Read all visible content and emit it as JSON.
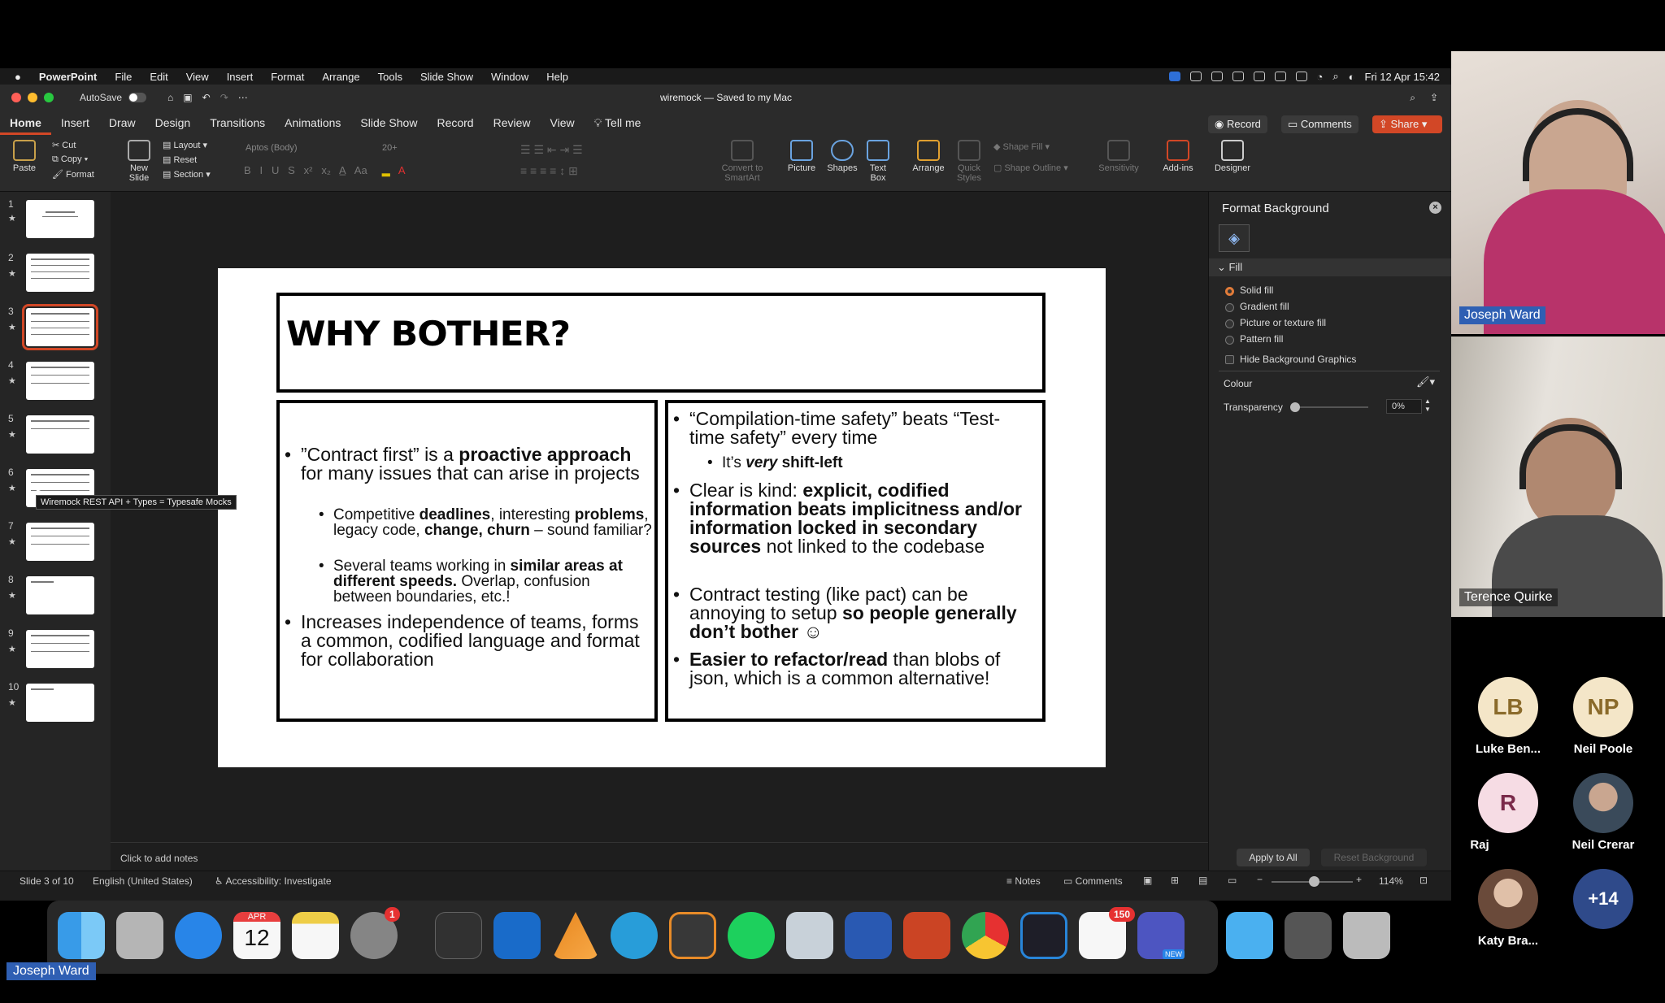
{
  "menubar": {
    "app": "PowerPoint",
    "items": [
      "File",
      "Edit",
      "View",
      "Insert",
      "Format",
      "Arrange",
      "Tools",
      "Slide Show",
      "Window",
      "Help"
    ],
    "clock": "Fri 12 Apr  15:42"
  },
  "titlebar": {
    "autosave": "AutoSave",
    "doc": "wiremock — Saved to my Mac"
  },
  "tabs": [
    "Home",
    "Insert",
    "Draw",
    "Design",
    "Transitions",
    "Animations",
    "Slide Show",
    "Record",
    "Review",
    "View"
  ],
  "tell_me": "Tell me",
  "buttons": {
    "record": "Record",
    "comments": "Comments",
    "share": "Share"
  },
  "ribbon": {
    "paste": "Paste",
    "cut": "Cut",
    "copy": "Copy",
    "format": "Format",
    "new_slide": "New Slide",
    "layout": "Layout",
    "reset": "Reset",
    "section": "Section",
    "font": "Aptos (Body)",
    "size": "20+",
    "convert": "Convert to SmartArt",
    "picture": "Picture",
    "shapes": "Shapes",
    "textbox": "Text Box",
    "arrange": "Arrange",
    "quick_styles": "Quick Styles",
    "shape_fill": "Shape Fill",
    "shape_outline": "Shape Outline",
    "sensitivity": "Sensitivity",
    "addins": "Add-ins",
    "designer": "Designer"
  },
  "slides": [
    "1",
    "2",
    "3",
    "4",
    "5",
    "6",
    "7",
    "8",
    "9",
    "10"
  ],
  "tooltip": "Wiremock REST API + Types = Typesafe Mocks",
  "slide": {
    "title": "WHY BOTHER?",
    "left": {
      "b1a": "”Contract first” is a ",
      "b1b": "proactive approach",
      "b1c": " for many issues that can arise in projects",
      "s1a": "Competitive ",
      "s1b": "deadlines",
      "s1c": ", interesting ",
      "s1d": "problems",
      "s1e": ", legacy code, ",
      "s1f": "change, churn",
      "s1g": " – sound familiar?",
      "s2a": "Several teams working in ",
      "s2b": "similar areas at different speeds.",
      "s2c": " Overlap, confusion between boundaries, etc.!",
      "b2": "Increases independence of teams, forms a common, codified language and format for collaboration"
    },
    "right": {
      "b1": "“Compilation-time safety” beats “Test-time safety” every time",
      "s1a": "It’s ",
      "s1b": "very",
      "s1c": " shift-left",
      "b2a": "Clear is kind: ",
      "b2b": "explicit, codified information beats implicitness and/or information locked in secondary sources",
      "b2c": " not linked to the codebase",
      "b3a": "Contract testing (like pact) can be annoying to setup ",
      "b3b": "so people generally don’t bother",
      "b3c": " ☺",
      "b4a": "Easier to refactor/read",
      "b4b": " than blobs of json, which is a common alternative!"
    }
  },
  "notes": "Click to add notes",
  "format_pane": {
    "title": "Format Background",
    "section": "Fill",
    "options": [
      "Solid fill",
      "Gradient fill",
      "Picture or texture fill",
      "Pattern fill"
    ],
    "hide": "Hide Background Graphics",
    "colour": "Colour",
    "transparency": "Transparency",
    "transparency_value": "0%",
    "apply": "Apply to All",
    "reset": "Reset Background"
  },
  "status": {
    "slide": "Slide 3 of 10",
    "lang": "English (United States)",
    "access": "Accessibility: Investigate",
    "notes": "Notes",
    "comments": "Comments",
    "zoom": "114%"
  },
  "participants": {
    "videos": [
      {
        "name": "Joseph Ward"
      },
      {
        "name": "Terence Quirke"
      }
    ],
    "tiles": [
      {
        "initials": "LB",
        "name": "Luke Ben..."
      },
      {
        "initials": "NP",
        "name": "Neil Poole"
      },
      {
        "initials": "R",
        "name": "Raj"
      },
      {
        "initials": "",
        "name": "Neil Crerar"
      },
      {
        "initials": "",
        "name": "Katy Bra..."
      },
      {
        "initials": "+14",
        "name": ""
      }
    ]
  },
  "dock": {
    "calendar_month": "APR",
    "calendar_day": "12",
    "settings_badge": "1",
    "slack_badge": "150",
    "teams_new": "NEW"
  },
  "share_label": "Joseph Ward"
}
